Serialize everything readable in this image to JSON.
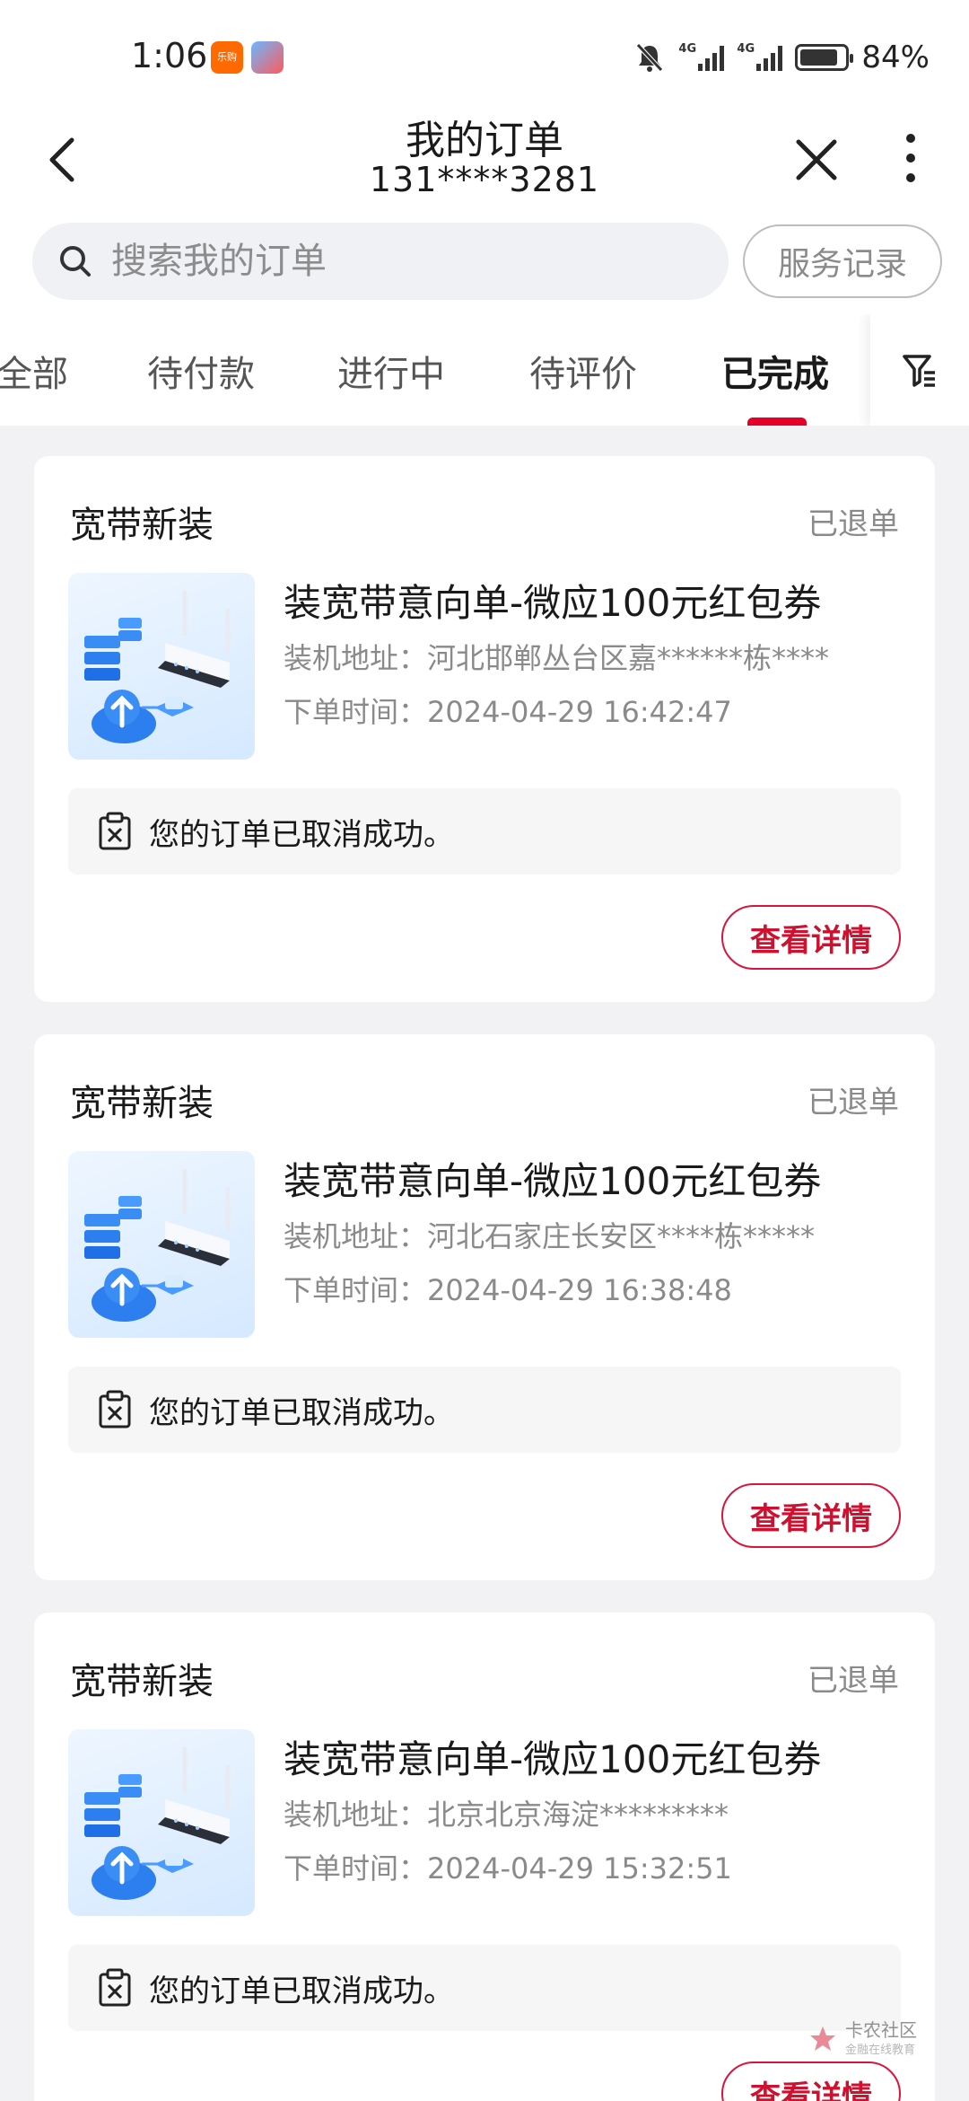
{
  "status_bar": {
    "time": "1:06",
    "badge1_text": "乐购",
    "signal1_label": "4G",
    "signal2_label": "4G",
    "battery_level": 0.84,
    "battery_text": "84%"
  },
  "header": {
    "title": "我的订单",
    "phone": "131****3281"
  },
  "search": {
    "placeholder": "搜索我的订单",
    "service_label": "服务记录"
  },
  "tabs": [
    {
      "label": "全部",
      "active": false
    },
    {
      "label": "待付款",
      "active": false
    },
    {
      "label": "进行中",
      "active": false
    },
    {
      "label": "待评价",
      "active": false
    },
    {
      "label": "已完成",
      "active": true
    }
  ],
  "orders": [
    {
      "type": "宽带新装",
      "status": "已退单",
      "product": "装宽带意向单-微应100元红包券",
      "address": "装机地址：河北邯郸丛台区嘉******栋****",
      "time": "下单时间：2024-04-29 16:42:47",
      "notice": "您的订单已取消成功。",
      "detail_label": "查看详情"
    },
    {
      "type": "宽带新装",
      "status": "已退单",
      "product": "装宽带意向单-微应100元红包券",
      "address": "装机地址：河北石家庄长安区****栋*****",
      "time": "下单时间：2024-04-29 16:38:48",
      "notice": "您的订单已取消成功。",
      "detail_label": "查看详情"
    },
    {
      "type": "宽带新装",
      "status": "已退单",
      "product": "装宽带意向单-微应100元红包券",
      "address": "装机地址：北京北京海淀*********",
      "time": "下单时间：2024-04-29 15:32:51",
      "notice": "您的订单已取消成功。",
      "detail_label": "查看详情"
    }
  ],
  "watermark": {
    "text": "卡农社区",
    "sub": "金融在线教育"
  },
  "colors": {
    "accent": "#e60027",
    "page_bg": "#f2f2f4"
  }
}
